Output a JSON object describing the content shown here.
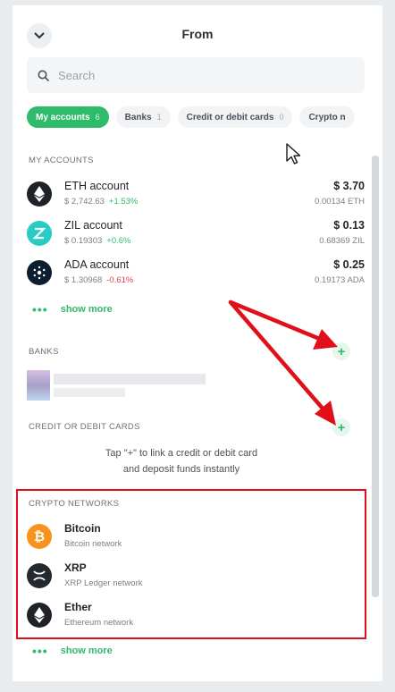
{
  "header": {
    "title": "From",
    "back_icon": "chevron-down-icon"
  },
  "search": {
    "placeholder": "Search",
    "value": ""
  },
  "tabs": [
    {
      "label": "My accounts",
      "count": "6",
      "active": true
    },
    {
      "label": "Banks",
      "count": "1",
      "active": false
    },
    {
      "label": "Credit or debit cards",
      "count": "0",
      "active": false
    },
    {
      "label": "Crypto n",
      "count": "",
      "active": false
    }
  ],
  "my_accounts": {
    "title": "MY ACCOUNTS",
    "items": [
      {
        "name": "ETH account",
        "price": "$ 2,742.63",
        "change": "+1.53%",
        "fiat": "$ 3.70",
        "crypto": "0.00134 ETH",
        "icon": "ethereum-icon",
        "color": "#1f2328"
      },
      {
        "name": "ZIL account",
        "price": "$ 0.19303",
        "change": "+0.6%",
        "fiat": "$ 0.13",
        "crypto": "0.68369 ZIL",
        "icon": "zilliqa-icon",
        "color": "#29ccc4"
      },
      {
        "name": "ADA account",
        "price": "$ 1.30968",
        "change": "-0.61%",
        "fiat": "$ 0.25",
        "crypto": "0.19173 ADA",
        "icon": "cardano-icon",
        "color": "#0d1e30"
      }
    ],
    "show_more": "show more"
  },
  "banks": {
    "title": "BANKS",
    "add_icon": "plus-icon"
  },
  "cards": {
    "title": "CREDIT OR DEBIT CARDS",
    "hint_line1": "Tap \"+\" to link a credit or debit card",
    "hint_line2": "and deposit funds instantly",
    "add_icon": "plus-icon"
  },
  "networks": {
    "title": "CRYPTO NETWORKS",
    "items": [
      {
        "name": "Bitcoin",
        "sub": "Bitcoin network",
        "icon": "bitcoin-icon",
        "color": "#f7931a"
      },
      {
        "name": "XRP",
        "sub": "XRP Ledger network",
        "icon": "xrp-icon",
        "color": "#23292f"
      },
      {
        "name": "Ether",
        "sub": "Ethereum network",
        "icon": "ethereum-icon",
        "color": "#1f2328"
      }
    ],
    "show_more": "show more"
  },
  "colors": {
    "accent": "#2fbc6a",
    "annotation": "#e0101a",
    "negative": "#e0454b"
  }
}
